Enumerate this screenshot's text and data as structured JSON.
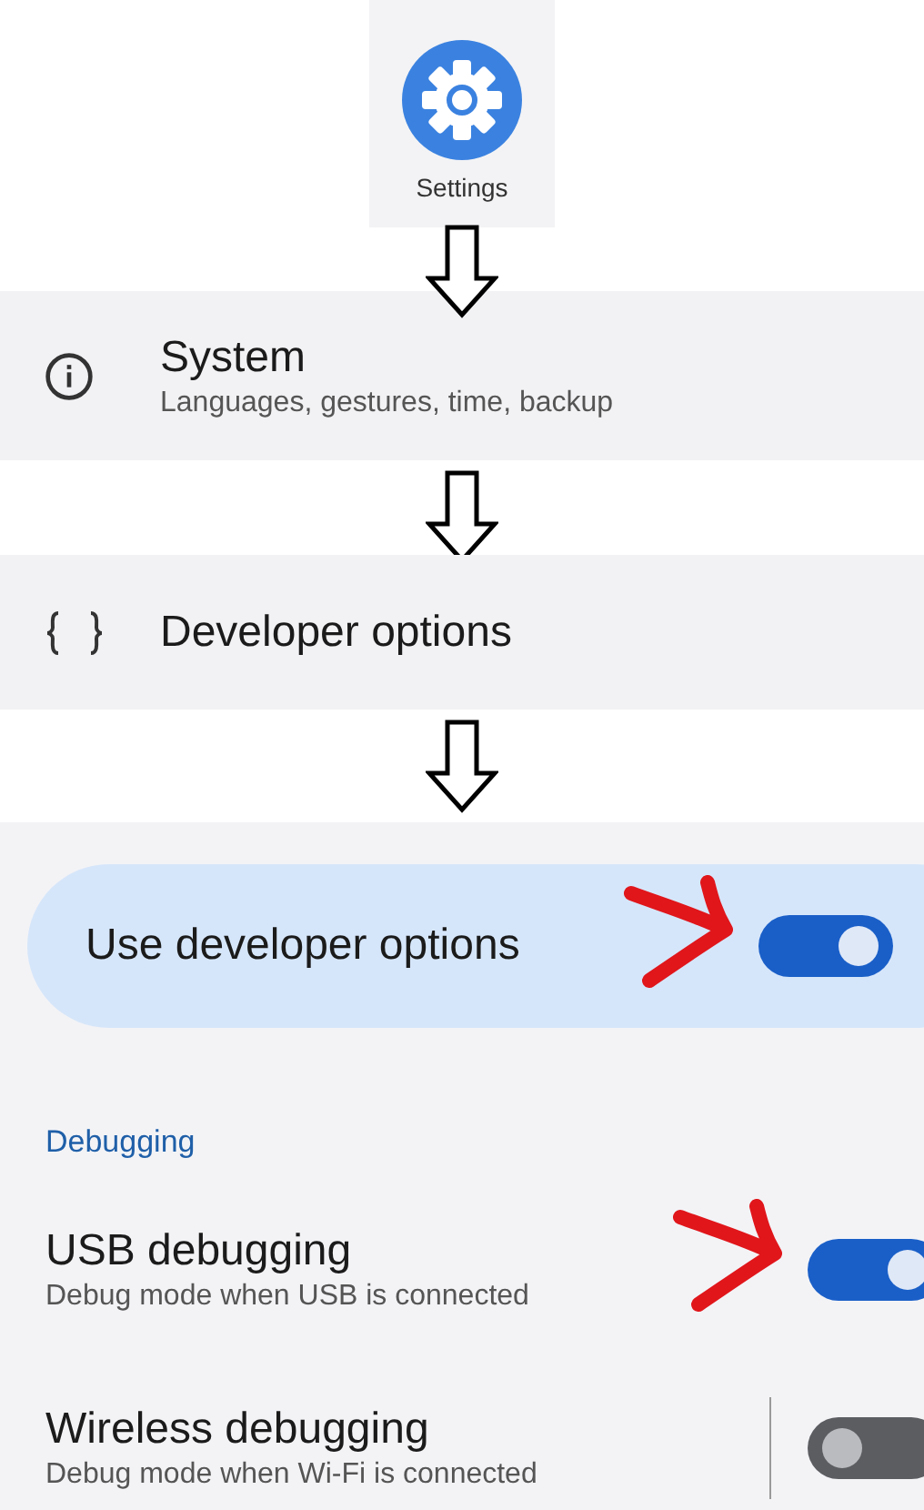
{
  "app_icon": {
    "label": "Settings"
  },
  "menu_items": [
    {
      "kind": "info",
      "title": "System",
      "subtitle": "Languages, gestures, time, backup"
    },
    {
      "kind": "braces",
      "title": "Developer options"
    }
  ],
  "main_switch": {
    "label": "Use developer options",
    "on": true,
    "highlighted": true
  },
  "section": {
    "title": "Debugging"
  },
  "toggles": [
    {
      "title": "USB debugging",
      "subtitle": "Debug mode when USB is connected",
      "on": true,
      "highlighted": true,
      "divider": false
    },
    {
      "title": "Wireless debugging",
      "subtitle": "Debug mode when Wi-Fi is connected",
      "on": false,
      "highlighted": false,
      "divider": true
    }
  ]
}
